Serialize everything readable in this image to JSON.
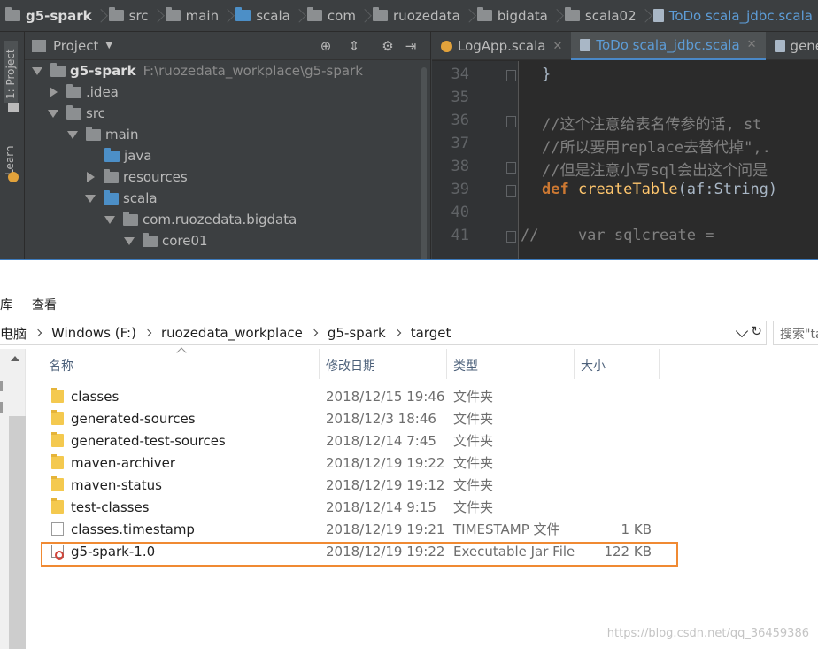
{
  "ide": {
    "breadcrumb": [
      "g5-spark",
      "src",
      "main",
      "scala",
      "com",
      "ruozedata",
      "bigdata",
      "scala02",
      "ToDo scala_jdbc.scala"
    ],
    "side_tabs": {
      "project": "1: Project",
      "learn": "Learn"
    },
    "project_panel": {
      "title": "Project",
      "tree": [
        {
          "label": "g5-spark",
          "path": "F:\\ruozedata_workplace\\g5-spark",
          "expanded": true
        },
        {
          "label": ".idea",
          "expanded": false
        },
        {
          "label": "src",
          "expanded": true
        },
        {
          "label": "main",
          "expanded": true
        },
        {
          "label": "java"
        },
        {
          "label": "resources",
          "expanded": false
        },
        {
          "label": "scala",
          "expanded": true
        },
        {
          "label": "com.ruozedata.bigdata",
          "expanded": true
        },
        {
          "label": "core01",
          "expanded": true
        }
      ]
    },
    "editor": {
      "tabs": [
        {
          "label": "LogApp.scala",
          "active": false
        },
        {
          "label": "ToDo scala_jdbc.scala",
          "active": true
        },
        {
          "label": "generat",
          "active": false
        }
      ],
      "lines": [
        {
          "num": "34",
          "text": "}"
        },
        {
          "num": "35",
          "text": ""
        },
        {
          "num": "36",
          "text": "//这个注意给表名传参的话, st"
        },
        {
          "num": "37",
          "text": "//所以要用replace去替代掉\",."
        },
        {
          "num": "38",
          "text": "//但是注意小写sql会出这个问是"
        },
        {
          "num": "39",
          "keyword": "def",
          "fn": "createTable",
          "rest": "(af:String)"
        },
        {
          "num": "40",
          "text": ""
        },
        {
          "num": "41",
          "slash": "//",
          "text": "    var sqlcreate ="
        }
      ]
    }
  },
  "explorer": {
    "ribbon": {
      "left": "库",
      "view": "查看"
    },
    "address": [
      "电脑",
      "Windows (F:)",
      "ruozedata_workplace",
      "g5-spark",
      "target"
    ],
    "search_placeholder": "搜索\"ta",
    "columns": {
      "name": "名称",
      "date": "修改日期",
      "type": "类型",
      "size": "大小"
    },
    "files": [
      {
        "name": "classes",
        "date": "2018/12/15 19:46",
        "type": "文件夹",
        "size": "",
        "kind": "folder"
      },
      {
        "name": "generated-sources",
        "date": "2018/12/3 18:46",
        "type": "文件夹",
        "size": "",
        "kind": "folder"
      },
      {
        "name": "generated-test-sources",
        "date": "2018/12/14 7:45",
        "type": "文件夹",
        "size": "",
        "kind": "folder"
      },
      {
        "name": "maven-archiver",
        "date": "2018/12/19 19:22",
        "type": "文件夹",
        "size": "",
        "kind": "folder"
      },
      {
        "name": "maven-status",
        "date": "2018/12/19 19:12",
        "type": "文件夹",
        "size": "",
        "kind": "folder"
      },
      {
        "name": "test-classes",
        "date": "2018/12/14 9:15",
        "type": "文件夹",
        "size": "",
        "kind": "folder"
      },
      {
        "name": "classes.timestamp",
        "date": "2018/12/19 19:21",
        "type": "TIMESTAMP 文件",
        "size": "1 KB",
        "kind": "file"
      },
      {
        "name": "g5-spark-1.0",
        "date": "2018/12/19 19:22",
        "type": "Executable Jar File",
        "size": "122 KB",
        "kind": "jar"
      }
    ],
    "watermark": "https://blog.csdn.net/qq_36459386"
  },
  "colors": {
    "ide_bg": "#3c3f41",
    "editor_bg": "#2b2b2b",
    "comment": "#808080",
    "keyword": "#cc7832",
    "function": "#ffc66d",
    "highlight_box": "#f08a33",
    "folder": "#f4c94f"
  }
}
